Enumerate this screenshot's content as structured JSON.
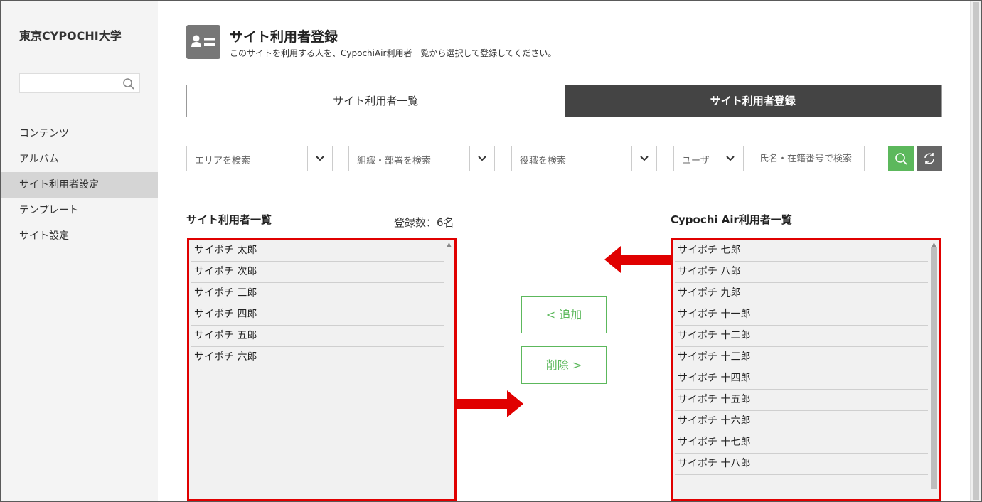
{
  "sidebar": {
    "site_name": "東京CYPOCHI大学",
    "search_placeholder": "",
    "items": [
      {
        "label": "コンテンツ"
      },
      {
        "label": "アルバム"
      },
      {
        "label": "サイト利用者設定",
        "active": true
      },
      {
        "label": "テンプレート"
      },
      {
        "label": "サイト設定"
      }
    ]
  },
  "header": {
    "icon": "user-card-icon",
    "title": "サイト利用者登録",
    "description": "このサイトを利用する人を、CypochiAir利用者一覧から選択して登録してください。"
  },
  "tabs": [
    {
      "label": "サイト利用者一覧",
      "active": false
    },
    {
      "label": "サイト利用者登録",
      "active": true
    }
  ],
  "filters": {
    "area": "エリアを検索",
    "org": "組織・部署を検索",
    "role": "役職を検索",
    "type": "ユーザ",
    "name_placeholder": "氏名・在籍番号で検索"
  },
  "left_list": {
    "title": "サイト利用者一覧",
    "count": "登録数：6名",
    "items": [
      "サイポチ 太郎",
      "サイポチ 次郎",
      "サイポチ 三郎",
      "サイポチ 四郎",
      "サイポチ 五郎",
      "サイポチ 六郎"
    ]
  },
  "right_list": {
    "title": "Cypochi Air利用者一覧",
    "items": [
      "サイポチ 七郎",
      "サイポチ 八郎",
      "サイポチ 九郎",
      "サイポチ 十一郎",
      "サイポチ 十二郎",
      "サイポチ 十三郎",
      "サイポチ 十四郎",
      "サイポチ 十五郎",
      "サイポチ 十六郎",
      "サイポチ 十七郎",
      "サイポチ 十八郎",
      ""
    ]
  },
  "buttons": {
    "add": "< 追加",
    "remove": "削除 >"
  },
  "colors": {
    "accent_green": "#5cb85c",
    "highlight_red": "#e00000",
    "active_tab": "#444444"
  }
}
